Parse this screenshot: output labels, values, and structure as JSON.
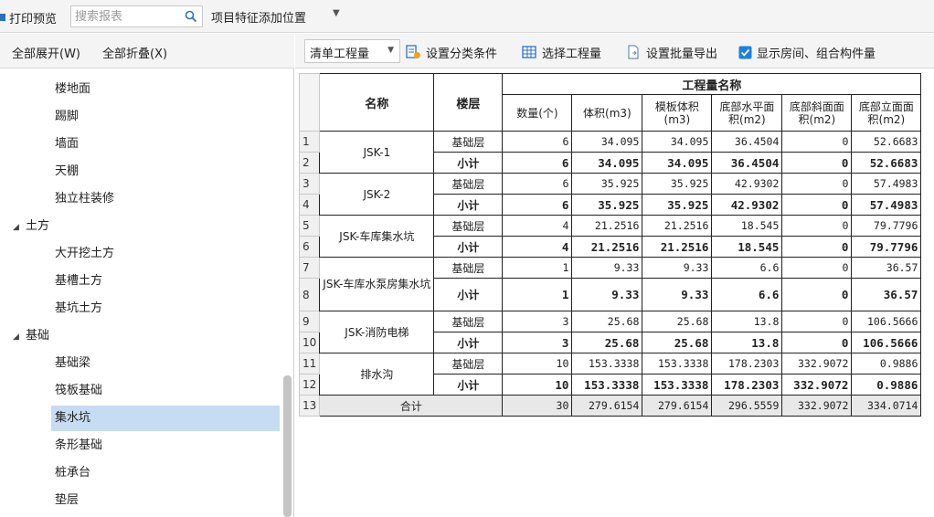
{
  "toolbar": {
    "print_preview": "打印预览",
    "search_placeholder": "搜索报表",
    "feature_position": "项目特征添加位置"
  },
  "left_panel": {
    "expand_all": "全部展开(W)",
    "collapse_all": "全部折叠(X)",
    "tree": [
      {
        "label": "楼地面",
        "level": "child"
      },
      {
        "label": "踢脚",
        "level": "child"
      },
      {
        "label": "墙面",
        "level": "child"
      },
      {
        "label": "天棚",
        "level": "child"
      },
      {
        "label": "独立柱装修",
        "level": "child"
      },
      {
        "label": "土方",
        "level": "group"
      },
      {
        "label": "大开挖土方",
        "level": "child"
      },
      {
        "label": "基槽土方",
        "level": "child"
      },
      {
        "label": "基坑土方",
        "level": "child"
      },
      {
        "label": "基础",
        "level": "group"
      },
      {
        "label": "基础梁",
        "level": "child"
      },
      {
        "label": "筏板基础",
        "level": "child"
      },
      {
        "label": "集水坑",
        "level": "child",
        "selected": true
      },
      {
        "label": "条形基础",
        "level": "child"
      },
      {
        "label": "桩承台",
        "level": "child"
      },
      {
        "label": "垫层",
        "level": "child"
      }
    ]
  },
  "right_toolbar": {
    "qty_select": "清单工程量",
    "set_category": "设置分类条件",
    "select_qty": "选择工程量",
    "batch_export": "设置批量导出",
    "show_rooms": "显示房间、组合构件量",
    "show_rooms_checked": true
  },
  "table": {
    "headers": {
      "name": "名称",
      "floor": "楼层",
      "group": "工程量名称",
      "cols": [
        "数量(个)",
        "体积(m3)",
        "模板体积(m3)",
        "底部水平面积(m2)",
        "底部斜面面积(m2)",
        "底部立面面积(m2)"
      ]
    },
    "groups": [
      {
        "name": "JSK-1",
        "rows": [
          {
            "rn": "1",
            "floor": "基础层",
            "vals": [
              "6",
              "34.095",
              "34.095",
              "36.4504",
              "0",
              "52.6683"
            ],
            "subtotal": false
          },
          {
            "rn": "2",
            "floor": "小计",
            "vals": [
              "6",
              "34.095",
              "34.095",
              "36.4504",
              "0",
              "52.6683"
            ],
            "subtotal": true
          }
        ]
      },
      {
        "name": "JSK-2",
        "rows": [
          {
            "rn": "3",
            "floor": "基础层",
            "vals": [
              "6",
              "35.925",
              "35.925",
              "42.9302",
              "0",
              "57.4983"
            ],
            "subtotal": false
          },
          {
            "rn": "4",
            "floor": "小计",
            "vals": [
              "6",
              "35.925",
              "35.925",
              "42.9302",
              "0",
              "57.4983"
            ],
            "subtotal": true
          }
        ]
      },
      {
        "name": "JSK-车库集水坑",
        "rows": [
          {
            "rn": "5",
            "floor": "基础层",
            "vals": [
              "4",
              "21.2516",
              "21.2516",
              "18.545",
              "0",
              "79.7796"
            ],
            "subtotal": false
          },
          {
            "rn": "6",
            "floor": "小计",
            "vals": [
              "4",
              "21.2516",
              "21.2516",
              "18.545",
              "0",
              "79.7796"
            ],
            "subtotal": true
          }
        ]
      },
      {
        "name": "JSK-车库水泵房集水坑",
        "rows": [
          {
            "rn": "7",
            "floor": "基础层",
            "vals": [
              "1",
              "9.33",
              "9.33",
              "6.6",
              "0",
              "36.57"
            ],
            "subtotal": false
          },
          {
            "rn": "8",
            "floor": "小计",
            "vals": [
              "1",
              "9.33",
              "9.33",
              "6.6",
              "0",
              "36.57"
            ],
            "subtotal": true
          }
        ]
      },
      {
        "name": "JSK-消防电梯",
        "rows": [
          {
            "rn": "9",
            "floor": "基础层",
            "vals": [
              "3",
              "25.68",
              "25.68",
              "13.8",
              "0",
              "106.5666"
            ],
            "subtotal": false
          },
          {
            "rn": "10",
            "floor": "小计",
            "vals": [
              "3",
              "25.68",
              "25.68",
              "13.8",
              "0",
              "106.5666"
            ],
            "subtotal": true
          }
        ]
      },
      {
        "name": "排水沟",
        "rows": [
          {
            "rn": "11",
            "floor": "基础层",
            "vals": [
              "10",
              "153.3338",
              "153.3338",
              "178.2303",
              "332.9072",
              "0.9886"
            ],
            "subtotal": false
          },
          {
            "rn": "12",
            "floor": "小计",
            "vals": [
              "10",
              "153.3338",
              "153.3338",
              "178.2303",
              "332.9072",
              "0.9886"
            ],
            "subtotal": true
          }
        ]
      }
    ],
    "total": {
      "rn": "13",
      "label": "合计",
      "vals": [
        "30",
        "279.6154",
        "279.6154",
        "296.5559",
        "332.9072",
        "334.0714"
      ]
    }
  }
}
